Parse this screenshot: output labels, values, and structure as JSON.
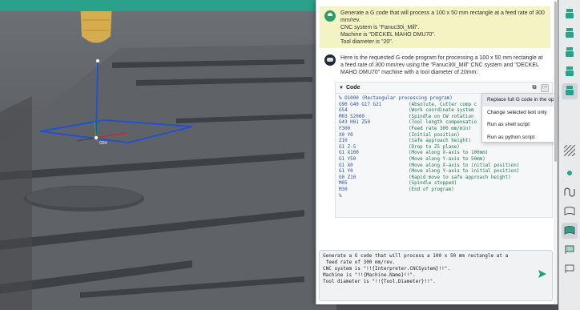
{
  "colors": {
    "accent": "#2aa18a",
    "user_bubble": "#f3f3c4",
    "code_keyword": "#2a4fb0",
    "code_comment": "#1a7a4a",
    "send": "#1aa37a"
  },
  "chat": {
    "user_message": {
      "lines": [
        "Generate a G code that will process a 100 x 50 mm rectangle at a feed rate of 300",
        "mm/rev.",
        "CNC system is \"Fanuc30i_Mill\".",
        "Machine is \"DECKEL MAHO DMU70\".",
        "Tool diameter is \"20\"."
      ]
    },
    "bot_message": {
      "intro": "Here is the requested G-code program for processing a 100 x 50 mm rectangle at a feed rate of 300 mm/rev using the \"Fanuc30i_Mill\" CNC system and \"DECKEL MAHO DMU70\" machine with a tool diameter of 20mm:"
    },
    "code": {
      "title": "Code",
      "rows": [
        {
          "code": "% O1000 (Rectangular processing program)",
          "comment": ""
        },
        {
          "code": "G90 G40 G17 G21",
          "comment": "(Absolute, Cutter comp c"
        },
        {
          "code": "G54",
          "comment": "(Work coordinate system"
        },
        {
          "code": "M03 S2000",
          "comment": "(Spindle on CW rotation"
        },
        {
          "code": "G43 H01 Z50",
          "comment": "(Tool length compensatio"
        },
        {
          "code": "F300",
          "comment": "(Feed rate 300 mm/min)"
        },
        {
          "code": "X0 Y0",
          "comment": "(Initial position)"
        },
        {
          "code": "Z10",
          "comment": "(Safe approach height)"
        },
        {
          "code": "G1 Z-5",
          "comment": "(Drop to Z5 plane)"
        },
        {
          "code": "G1 X100",
          "comment": "(Move along X-axis to 100mm)"
        },
        {
          "code": "G1 Y50",
          "comment": "(Move along Y-axis to 50mm)"
        },
        {
          "code": "G1 X0",
          "comment": "(Move along X-axis to initial position)"
        },
        {
          "code": "G1 Y0",
          "comment": "(Move along Y-axis to initial position)"
        },
        {
          "code": "G0 Z10",
          "comment": "(Rapid move to safe approach height)"
        },
        {
          "code": "M05",
          "comment": "(Spindle stopped)"
        },
        {
          "code": "M30",
          "comment": "(End of program)"
        },
        {
          "code": "%",
          "comment": ""
        }
      ]
    },
    "menu": {
      "items": [
        "Replace full G code in the operation",
        "Change selected text only",
        "Run as shell script",
        "Run as python script"
      ]
    },
    "input": {
      "value": "Generate a G code that will process a 100 x 50 mm rectangle at a\n feed rate of 300 mm/rev.\nCNC system is \"!!{Interpreter.CNCSystem}!!\".\nMachine is \"!!{Machine.Name}!!\".\nTool diameter is \"!!{Tool.Diameter}!!\"."
    }
  },
  "viewport": {
    "axis_label": "G54"
  },
  "toolbar": {
    "icons": [
      "tool-icon",
      "tool-icon",
      "tool-icon",
      "tool-icon",
      "tool-icon",
      "hatch-icon",
      "dot-icon",
      "wave-icon",
      "flag-icon",
      "flag-icon",
      "flag-icon",
      "flag-icon"
    ]
  }
}
